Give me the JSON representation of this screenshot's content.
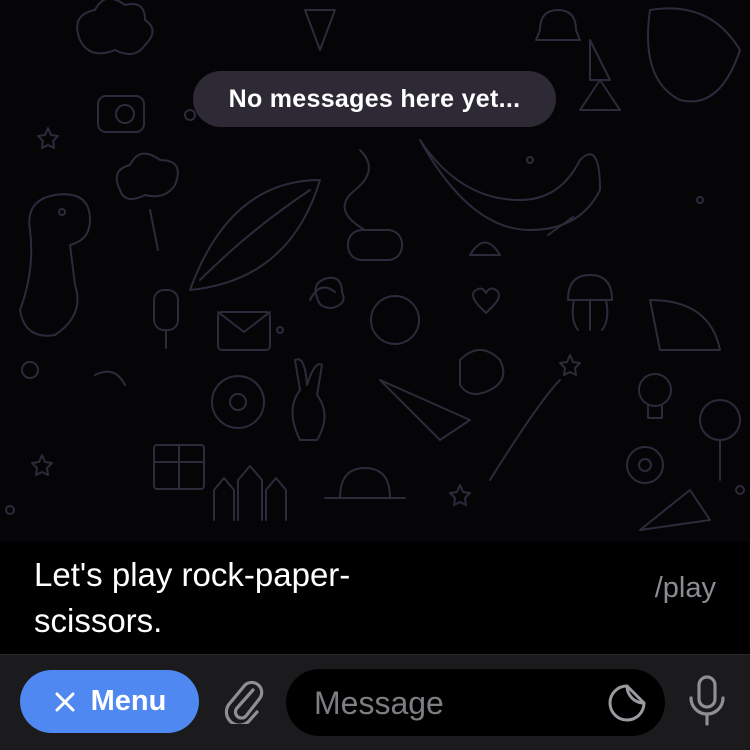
{
  "chat": {
    "empty_text": "No messages here yet..."
  },
  "command": {
    "description": "Let's play rock-paper-scissors.",
    "name": "/play"
  },
  "input_bar": {
    "menu_label": "Menu",
    "message_placeholder": "Message"
  },
  "colors": {
    "accent": "#4f88f0",
    "input_bar_bg": "#1b1b1d",
    "pill_bg": "#3a3442"
  }
}
